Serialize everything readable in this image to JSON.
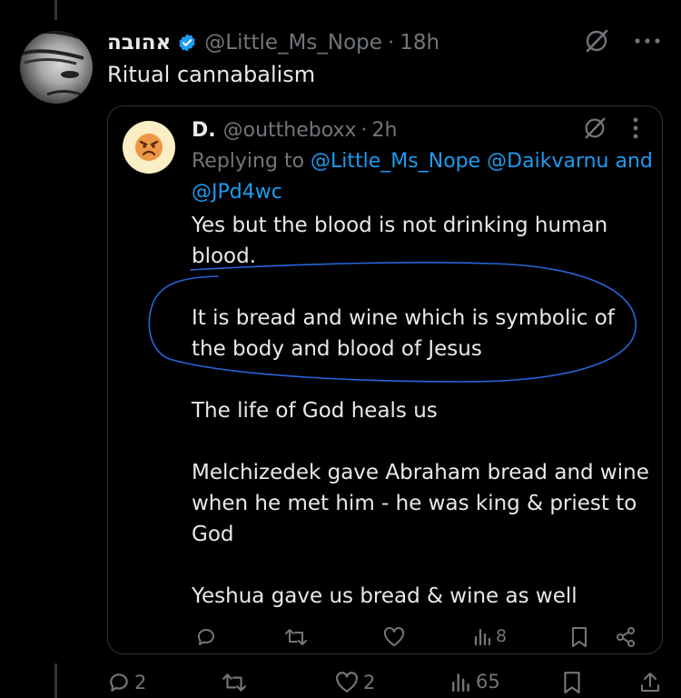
{
  "post": {
    "display_name": "אהובה",
    "handle": "@Little_Ms_Nope",
    "separator": "·",
    "time": "18h",
    "text": "Ritual cannabalism",
    "replies": "2",
    "likes": "2",
    "views": "65"
  },
  "quoted": {
    "display_name": "D.",
    "handle": "@outtheboxx",
    "separator": "·",
    "time": "2h",
    "replying_prefix": "Replying to",
    "mention_1": "@Little_Ms_Nope",
    "mention_2": "@Daikvarnu",
    "and": "and",
    "mention_3": "@JPd4wc",
    "body": [
      "Yes but the blood is not drinking human blood.",
      "It is bread and wine which is symbolic of the body and blood of Jesus",
      "The life of God heals us",
      "Melchizedek gave Abraham bread and wine when he met him - he was king & priest to God",
      "Yeshua gave us bread & wine as well"
    ],
    "views": "8"
  },
  "colors": {
    "background": "#000000",
    "text": "#e7e9ea",
    "muted": "#71767b",
    "link": "#1d9bf0",
    "verified": "#1d9bf0",
    "annotation_ink": "#2a63d8"
  },
  "icons": [
    "verified-badge-icon",
    "grok-icon",
    "more-icon",
    "reply-icon",
    "repost-icon",
    "like-icon",
    "views-icon",
    "bookmark-icon",
    "share-icon"
  ]
}
